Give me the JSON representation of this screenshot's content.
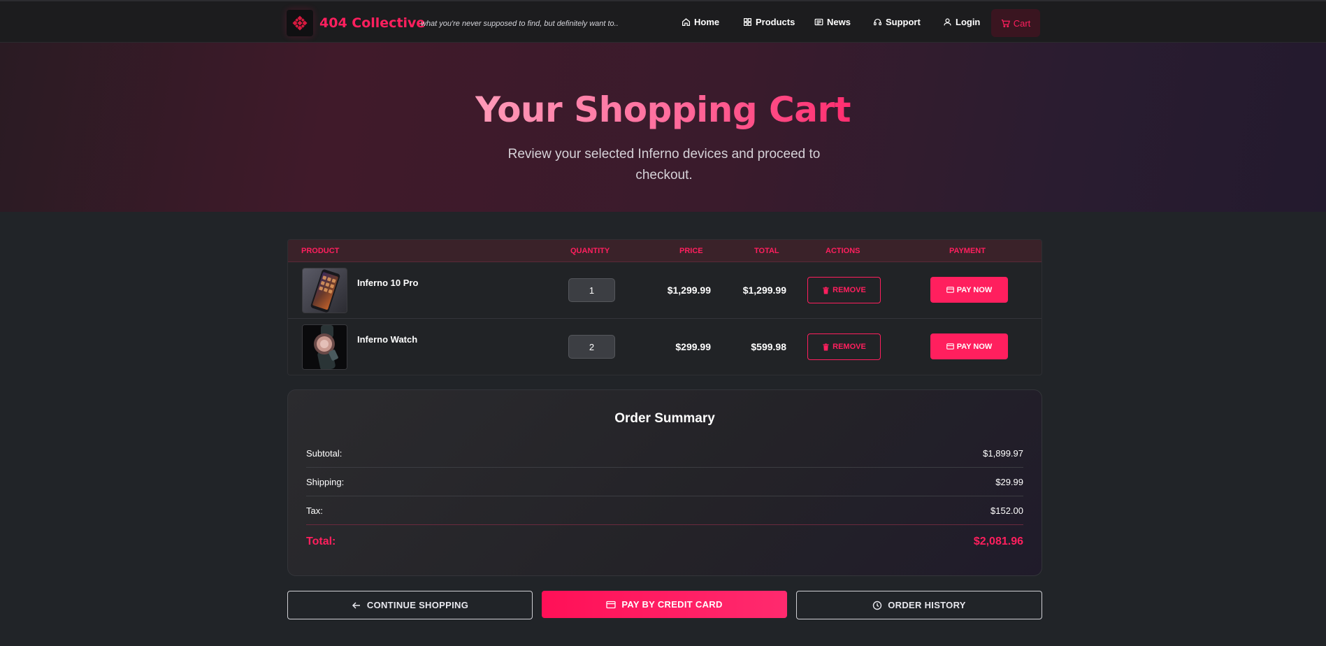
{
  "colors": {
    "accent": "#ff1f5e",
    "background": "#212428",
    "navbar": "#1c1c1e"
  },
  "navbar": {
    "brand_name": "404 Collective",
    "tagline": "what you're never supposed to find, but definitely want to..",
    "logo_icon": "diamond-logo-icon",
    "items": [
      {
        "label": "Home",
        "icon": "home-icon"
      },
      {
        "label": "Products",
        "icon": "grid-icon"
      },
      {
        "label": "News",
        "icon": "newspaper-icon"
      },
      {
        "label": "Support",
        "icon": "headset-icon"
      },
      {
        "label": "Login",
        "icon": "user-icon"
      }
    ],
    "cart": {
      "label": "Cart",
      "icon": "cart-icon"
    }
  },
  "hero": {
    "title": "Your Shopping Cart",
    "subtitle": "Review your selected Inferno devices and proceed to checkout."
  },
  "cart": {
    "columns": [
      "PRODUCT",
      "QUANTITY",
      "PRICE",
      "TOTAL",
      "ACTIONS",
      "PAYMENT"
    ],
    "items": [
      {
        "name": "Inferno 10 Pro",
        "quantity": "1",
        "price": "$1,299.99",
        "total": "$1,299.99",
        "remove_label": "REMOVE",
        "pay_label": "PAY NOW"
      },
      {
        "name": "Inferno Watch",
        "quantity": "2",
        "price": "$299.99",
        "total": "$599.98",
        "remove_label": "REMOVE",
        "pay_label": "PAY NOW"
      }
    ]
  },
  "summary": {
    "title": "Order Summary",
    "subtotal_label": "Subtotal:",
    "subtotal": "$1,899.97",
    "shipping_label": "Shipping:",
    "shipping": "$29.99",
    "tax_label": "Tax:",
    "tax": "$152.00",
    "total_label": "Total:",
    "total": "$2,081.96"
  },
  "actions": {
    "continue_label": "CONTINUE SHOPPING",
    "pay_card_label": "PAY BY CREDIT CARD",
    "history_label": "ORDER HISTORY"
  }
}
